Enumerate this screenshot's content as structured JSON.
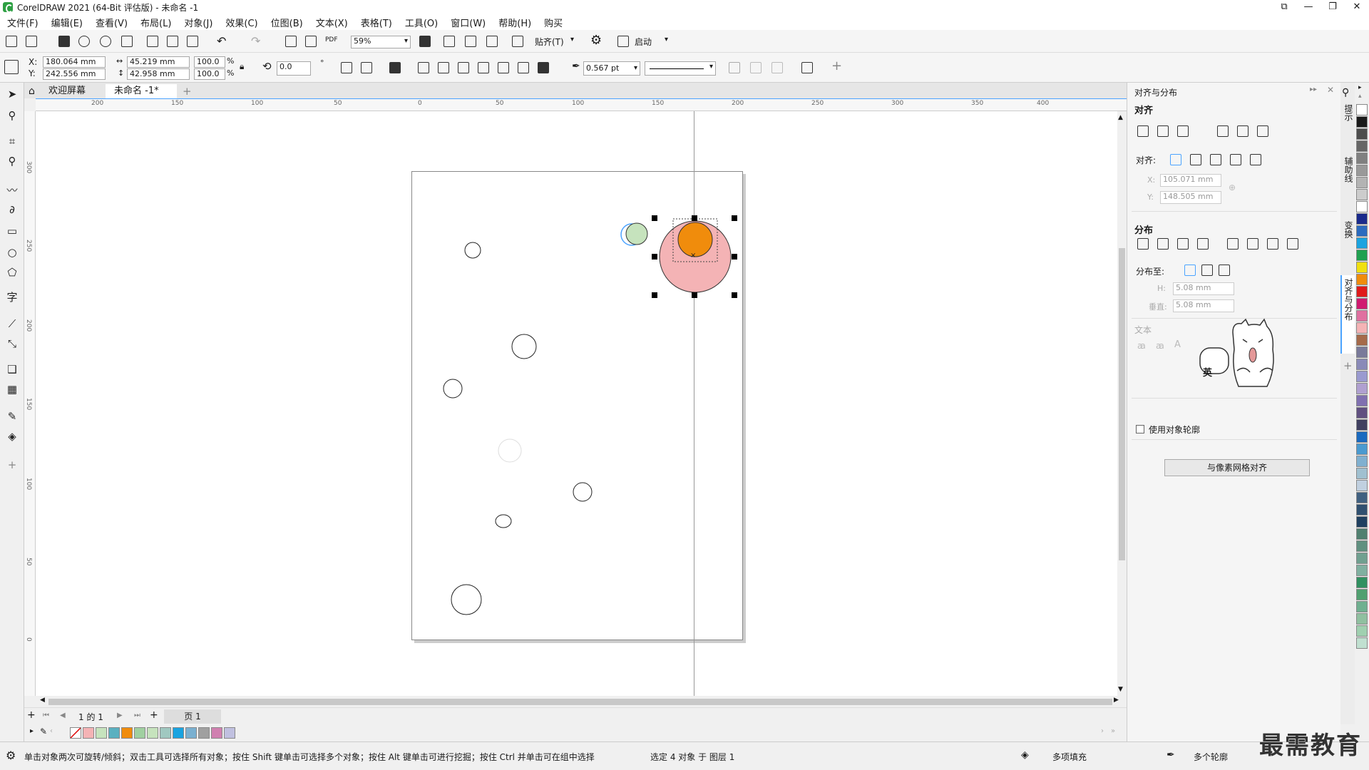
{
  "window": {
    "title": "CorelDRAW 2021 (64-Bit 评估版) - 未命名 -1"
  },
  "menu": [
    "文件(F)",
    "编辑(E)",
    "查看(V)",
    "布局(L)",
    "对象(J)",
    "效果(C)",
    "位图(B)",
    "文本(X)",
    "表格(T)",
    "工具(O)",
    "窗口(W)",
    "帮助(H)",
    "购买"
  ],
  "toolbar": {
    "zoom": "59%",
    "snap": "贴齐(T)",
    "launch": "启动"
  },
  "properties": {
    "x_label": "X:",
    "x": "180.064 mm",
    "y_label": "Y:",
    "y": "242.556 mm",
    "w": "45.219 mm",
    "h": "42.958 mm",
    "w_pct": "100.0",
    "h_pct": "100.0",
    "pct": "%",
    "angle": "0.0",
    "degree": "°",
    "outline": "0.567 pt"
  },
  "tabs": {
    "welcome": "欢迎屏幕",
    "doc": "未命名 -1*"
  },
  "hruler_ticks": [
    "200",
    "150",
    "100",
    "50",
    "0",
    "50",
    "100",
    "150",
    "200",
    "250",
    "300",
    "350",
    "400"
  ],
  "vruler_ticks": [
    "300",
    "250",
    "200",
    "150",
    "100",
    "50",
    "0"
  ],
  "pagenav": {
    "count": "1 的 1",
    "page": "页 1"
  },
  "docker": {
    "title": "对齐与分布",
    "align": "对齐",
    "align_to": "对齐:",
    "x_label": "X:",
    "x": "105.071 mm",
    "y_label": "Y:",
    "y": "148.505 mm",
    "distribute": "分布",
    "distribute_to": "分布至:",
    "h_label": "H:",
    "h": "5.08 mm",
    "v_label": "垂直:",
    "v": "5.08 mm",
    "text": "文本",
    "use_outline": "使用对象轮廓",
    "pixel_grid_button": "与像素网格对齐"
  },
  "docker_tabs": [
    "提示",
    "辅助线",
    "变换",
    "对齐与分布"
  ],
  "status": {
    "hint": "单击对象两次可旋转/倾斜；双击工具可选择所有对象；按住 Shift 键单击可选择多个对象；按住 Alt 键单击可进行挖掘；按住 Ctrl 并单击可在组中选择",
    "selection": "选定 4 对象 于 图层 1",
    "fill": "多项填充",
    "outline": "多个轮廓"
  },
  "ime_badge": "英",
  "watermark": "最需教育",
  "colors": {
    "orange": "#f08c0c",
    "pink": "#f4b3b5",
    "green": "#c6e3bd",
    "accent": "#4ba3ff"
  },
  "right_palette": [
    "#ffffff",
    "#1a1a1a",
    "#4d4d4d",
    "#666666",
    "#808080",
    "#999999",
    "#b3b3b3",
    "#cccccc",
    "#ffffff",
    "#1a2a8c",
    "#2b6bbf",
    "#1aa3e0",
    "#20a050",
    "#f0e010",
    "#f08c0c",
    "#e01a1a",
    "#d01a70",
    "#e070a0",
    "#f4b3b5",
    "#a56a4a",
    "#7a7a9a",
    "#8a8ab8",
    "#9a9ad0",
    "#b0a0d0",
    "#8070b0",
    "#605080",
    "#404060",
    "#1a6abf",
    "#4a9ad0",
    "#80b0d0",
    "#a0c0d0",
    "#c0d0e0",
    "#406080",
    "#305070",
    "#204060",
    "#508070",
    "#609080",
    "#70a090",
    "#80b0a0",
    "#309060",
    "#50a070",
    "#70b090",
    "#90c0a0",
    "#a0d0b0",
    "#c0e0d0"
  ],
  "bottom_palette": [
    "#f4b3b5",
    "#c6e3bd",
    "#5ab0c0",
    "#f08c0c",
    "#a0d0a0",
    "#c6e3bd",
    "#a0c8c0",
    "#1aa3e0",
    "#7ab0d0",
    "#a0a0a0",
    "#d080b0",
    "#c0c0e0"
  ]
}
